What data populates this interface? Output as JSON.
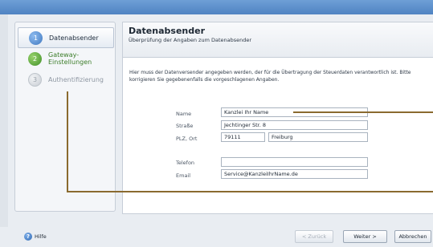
{
  "sidebar": {
    "steps": [
      {
        "number": "1",
        "label": "Datenabsender",
        "state": "active"
      },
      {
        "number": "2",
        "label": "Gateway-Einstellungen",
        "state": "done"
      },
      {
        "number": "3",
        "label": "Authentifizierung",
        "state": "pending"
      }
    ]
  },
  "header": {
    "title": "Datenabsender",
    "subtitle": "Überprüfung der Angaben zum Datenabsender"
  },
  "description": "Hier muss der Datenversender angegeben werden, der für die Übertragung der Steuerdaten verantwortlich ist. Bitte korrigieren Sie gegebenenfalls die vorgeschlagenen Angaben.",
  "form": {
    "name_label": "Name",
    "name_value": "Kanzlei Ihr Name",
    "street_label": "Straße",
    "street_value": "Jechtinger Str. 8",
    "city_label": "PLZ, Ort",
    "zip_value": "79111",
    "city_value": "Freiburg",
    "phone_label": "Telefon",
    "phone_value": "",
    "email_label": "Email",
    "email_value": "Service@KanzleiIhrName.de"
  },
  "footer": {
    "help_icon": "?",
    "help_label": "Hilfe",
    "back_label": "< Zurück",
    "next_label": "Weiter >",
    "cancel_label": "Abbrechen"
  },
  "colors": {
    "accent": "#3f78c0",
    "done": "#3f8f28",
    "annotation_line": "#8a6a2f"
  }
}
